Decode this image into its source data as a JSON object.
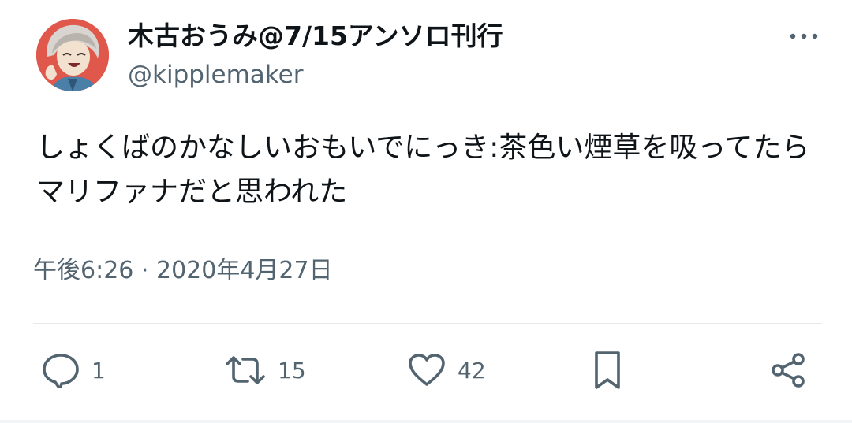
{
  "author": {
    "display_name": "木古おうみ@7/15アンソロ刊行",
    "handle": "@kipplemaker",
    "avatar_icon": "anime-character-avatar"
  },
  "tweet": {
    "text": "しょくばのかなしいおもいでにっき:茶色い煙草を吸ってたらマリファナだと思われた",
    "timestamp": "午後6:26 · 2020年4月27日"
  },
  "actions": {
    "reply_count": "1",
    "retweet_count": "15",
    "like_count": "42"
  },
  "colors": {
    "text_primary": "#0f1419",
    "text_secondary": "#536471",
    "divider": "#e6e9eb",
    "avatar_bg": "#e0584c"
  }
}
